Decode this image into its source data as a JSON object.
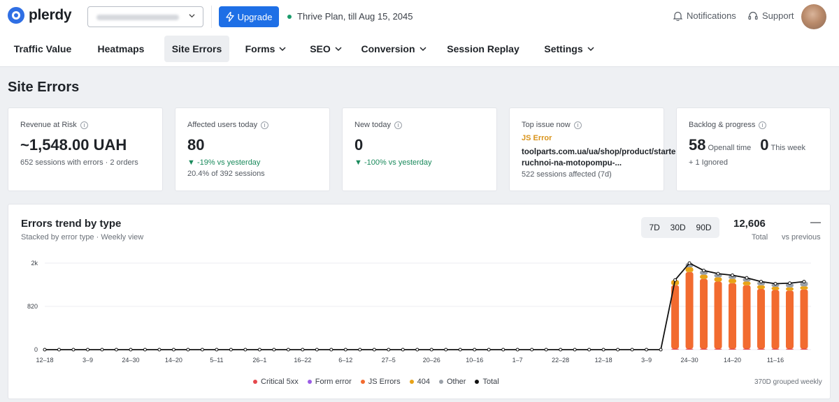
{
  "brand": {
    "name": "plerdy"
  },
  "header": {
    "upgrade_label": "Upgrade",
    "plan_text": "Thrive Plan, till Aug 15, 2045",
    "notifications_label": "Notifications",
    "support_label": "Support"
  },
  "nav": {
    "items": [
      {
        "label": "Traffic Value"
      },
      {
        "label": "Heatmaps"
      },
      {
        "label": "Site Errors"
      },
      {
        "label": "Forms"
      },
      {
        "label": "SEO"
      },
      {
        "label": "Conversion"
      },
      {
        "label": "Session Replay"
      },
      {
        "label": "Settings"
      }
    ]
  },
  "page": {
    "title": "Site Errors"
  },
  "cards": {
    "revenue": {
      "label": "Revenue at Risk",
      "value": "~1,548.00 UAH",
      "sub": "652 sessions with errors · 2 orders"
    },
    "affected": {
      "label": "Affected users today",
      "value": "80",
      "delta": "▼ -19% vs yesterday",
      "sub": "20.4% of 392 sessions"
    },
    "newtoday": {
      "label": "New today",
      "value": "0",
      "delta": "▼ -100% vs yesterday"
    },
    "topissue": {
      "label": "Top issue now",
      "tag": "JS Error",
      "url": "toolparts.com.ua/ua/shop/product/starter-ruchnoi-na-motopompu-...",
      "sub": "522 sessions affected (7d)"
    },
    "backlog": {
      "label": "Backlog & progress",
      "open_value": "58",
      "open_label": "Openall time",
      "week_value": "0",
      "week_label": "This week",
      "sub": "+ 1 Ignored"
    }
  },
  "trend": {
    "title": "Errors trend by type",
    "subtitle": "Stacked by error type · Weekly view",
    "ranges": [
      "7D",
      "30D",
      "90D"
    ],
    "total_value": "12,606",
    "total_label": "Total",
    "vs_value": "—",
    "vs_label": "vs previous",
    "grouped_note": "370D grouped weekly"
  },
  "colors": {
    "critical": "#e5484d",
    "form": "#9b5de5",
    "js": "#f26b2f",
    "e404": "#e8a317",
    "other": "#9aa0a8",
    "total": "#111111"
  },
  "chart_data": {
    "type": "bar",
    "stacked": true,
    "y_ticks": [
      "0",
      "820",
      "2k"
    ],
    "ylim": [
      0,
      1640
    ],
    "x_tick_labels": [
      "12–18",
      "3–9",
      "24–30",
      "14–20",
      "5–11",
      "26–1",
      "16–22",
      "6–12",
      "27–5",
      "20–26",
      "10–16",
      "1–7",
      "22–28",
      "12–18",
      "3–9",
      "24–30",
      "14–20",
      "11–16"
    ],
    "x_tick_indices": [
      0,
      3,
      6,
      9,
      12,
      15,
      18,
      21,
      24,
      27,
      30,
      33,
      36,
      39,
      42,
      45,
      48,
      51
    ],
    "series": [
      {
        "name": "Critical 5xx",
        "color_key": "critical",
        "values": [
          0,
          0,
          0,
          0,
          0,
          0,
          0,
          0,
          0,
          0,
          0,
          0,
          0,
          0,
          0,
          0,
          0,
          0,
          0,
          0,
          0,
          0,
          0,
          0,
          0,
          0,
          0,
          0,
          0,
          0,
          0,
          0,
          0,
          0,
          0,
          0,
          0,
          0,
          0,
          0,
          0,
          0,
          0,
          0,
          20,
          20,
          20,
          20,
          20,
          20,
          20,
          20,
          20,
          20
        ]
      },
      {
        "name": "Form error",
        "color_key": "form",
        "values": [
          0,
          0,
          0,
          0,
          0,
          0,
          0,
          0,
          0,
          0,
          0,
          0,
          0,
          0,
          0,
          0,
          0,
          0,
          0,
          0,
          0,
          0,
          0,
          0,
          0,
          0,
          0,
          0,
          0,
          0,
          0,
          0,
          0,
          0,
          0,
          0,
          0,
          0,
          0,
          0,
          0,
          0,
          0,
          0,
          0,
          0,
          0,
          0,
          0,
          0,
          0,
          0,
          0,
          0
        ]
      },
      {
        "name": "JS Errors",
        "color_key": "js",
        "values": [
          0,
          0,
          0,
          0,
          0,
          0,
          0,
          0,
          0,
          0,
          0,
          0,
          0,
          0,
          0,
          0,
          0,
          0,
          0,
          0,
          0,
          0,
          0,
          0,
          0,
          0,
          0,
          0,
          0,
          0,
          0,
          0,
          0,
          0,
          0,
          0,
          0,
          0,
          0,
          0,
          0,
          0,
          0,
          0,
          1200,
          1450,
          1320,
          1270,
          1240,
          1200,
          1130,
          1110,
          1100,
          1120
        ]
      },
      {
        "name": "404",
        "color_key": "e404",
        "values": [
          0,
          0,
          0,
          0,
          0,
          0,
          0,
          0,
          0,
          0,
          0,
          0,
          0,
          0,
          0,
          0,
          0,
          0,
          0,
          0,
          0,
          0,
          0,
          0,
          0,
          0,
          0,
          0,
          0,
          0,
          0,
          0,
          0,
          0,
          0,
          0,
          0,
          0,
          0,
          0,
          0,
          0,
          0,
          0,
          100,
          90,
          80,
          80,
          80,
          70,
          70,
          60,
          60,
          60
        ]
      },
      {
        "name": "Other",
        "color_key": "other",
        "values": [
          0,
          0,
          0,
          0,
          0,
          0,
          0,
          0,
          0,
          0,
          0,
          0,
          0,
          0,
          0,
          0,
          0,
          0,
          0,
          0,
          0,
          0,
          0,
          0,
          0,
          0,
          0,
          0,
          0,
          0,
          0,
          0,
          0,
          0,
          0,
          0,
          0,
          0,
          0,
          0,
          0,
          0,
          0,
          0,
          0,
          80,
          80,
          70,
          70,
          70,
          70,
          60,
          80,
          90
        ]
      }
    ],
    "line": {
      "name": "Total",
      "color_key": "total",
      "values": [
        0,
        0,
        0,
        0,
        0,
        0,
        0,
        0,
        0,
        0,
        0,
        0,
        0,
        0,
        0,
        0,
        0,
        0,
        0,
        0,
        0,
        0,
        0,
        0,
        0,
        0,
        0,
        0,
        0,
        0,
        0,
        0,
        0,
        0,
        0,
        0,
        0,
        0,
        0,
        0,
        0,
        0,
        0,
        0,
        1320,
        1640,
        1500,
        1440,
        1410,
        1360,
        1290,
        1250,
        1260,
        1290
      ]
    }
  }
}
